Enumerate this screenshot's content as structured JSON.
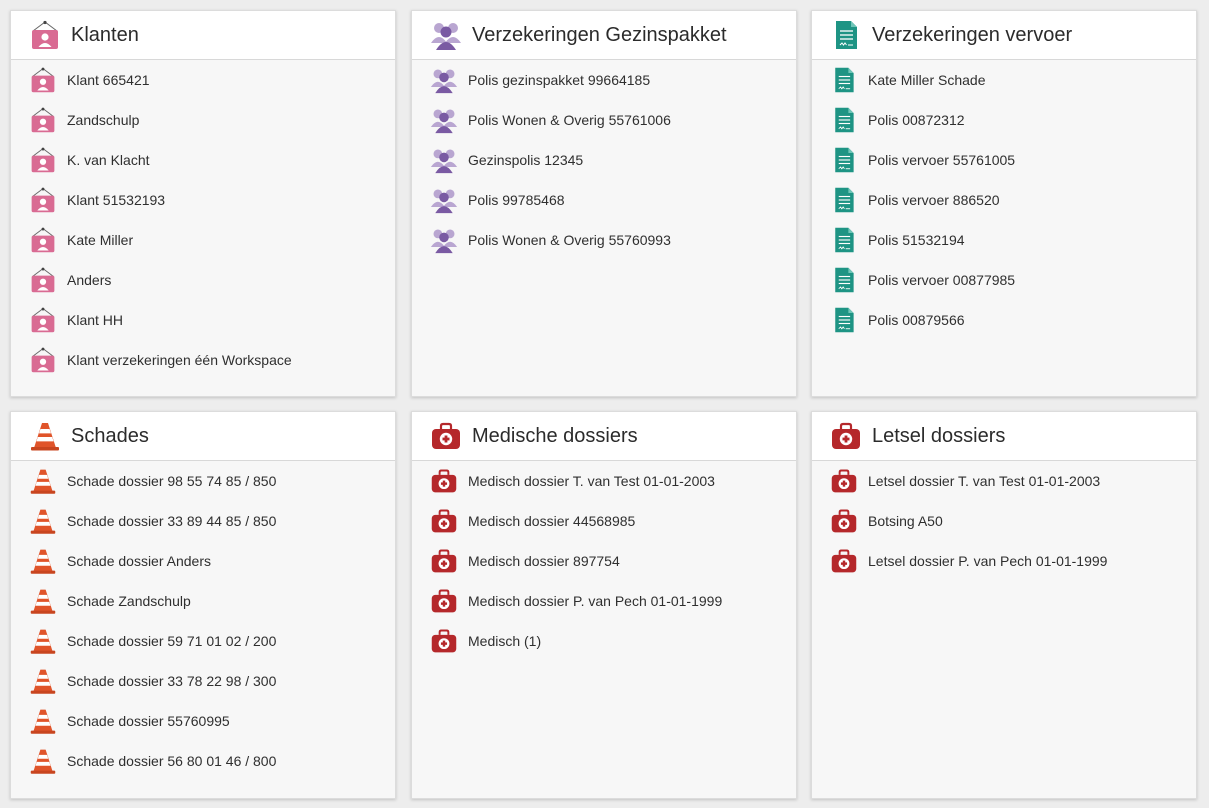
{
  "colors": {
    "klant": "#d96b93",
    "gezin": "#8a6aae",
    "vervoer": "#1e9484",
    "schade": "#e0542a",
    "medisch": "#b5282b"
  },
  "panels": [
    {
      "title": "Klanten",
      "icon": "client-card-icon",
      "items": [
        {
          "label": "Klant 665421"
        },
        {
          "label": "Zandschulp"
        },
        {
          "label": "K. van Klacht"
        },
        {
          "label": "Klant 51532193"
        },
        {
          "label": "Kate Miller"
        },
        {
          "label": "Anders"
        },
        {
          "label": "Klant HH"
        },
        {
          "label": "Klant verzekeringen één Workspace"
        }
      ]
    },
    {
      "title": "Verzekeringen Gezinspakket",
      "icon": "family-group-icon",
      "items": [
        {
          "label": "Polis gezinspakket 99664185"
        },
        {
          "label": "Polis Wonen & Overig 55761006"
        },
        {
          "label": "Gezinspolis 12345"
        },
        {
          "label": "Polis 99785468"
        },
        {
          "label": "Polis Wonen & Overig 55760993"
        }
      ]
    },
    {
      "title": "Verzekeringen vervoer",
      "icon": "policy-document-icon",
      "items": [
        {
          "label": "Kate Miller Schade"
        },
        {
          "label": "Polis 00872312"
        },
        {
          "label": "Polis vervoer 55761005"
        },
        {
          "label": "Polis vervoer 886520"
        },
        {
          "label": "Polis 51532194"
        },
        {
          "label": "Polis vervoer 00877985"
        },
        {
          "label": "Polis 00879566"
        }
      ]
    },
    {
      "title": "Schades",
      "icon": "traffic-cone-icon",
      "items": [
        {
          "label": "Schade dossier 98 55 74 85 / 850"
        },
        {
          "label": "Schade dossier 33 89 44 85 / 850"
        },
        {
          "label": "Schade dossier Anders"
        },
        {
          "label": "Schade Zandschulp"
        },
        {
          "label": "Schade dossier 59 71 01 02 / 200"
        },
        {
          "label": "Schade dossier 33 78 22 98 / 300"
        },
        {
          "label": "Schade dossier 55760995"
        },
        {
          "label": "Schade dossier 56 80 01 46 / 800"
        }
      ]
    },
    {
      "title": "Medische dossiers",
      "icon": "medical-kit-icon",
      "items": [
        {
          "label": "Medisch dossier T. van Test 01-01-2003"
        },
        {
          "label": "Medisch dossier 44568985"
        },
        {
          "label": "Medisch dossier 897754"
        },
        {
          "label": "Medisch dossier P. van Pech 01-01-1999"
        },
        {
          "label": "Medisch (1)"
        }
      ]
    },
    {
      "title": "Letsel dossiers",
      "icon": "medical-kit-icon",
      "items": [
        {
          "label": "Letsel dossier T. van Test 01-01-2003"
        },
        {
          "label": "Botsing A50"
        },
        {
          "label": "Letsel dossier P. van Pech 01-01-1999"
        }
      ]
    }
  ]
}
